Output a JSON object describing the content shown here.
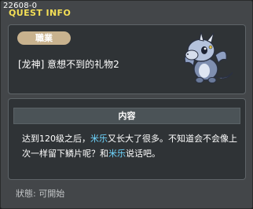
{
  "quest_id": "22608-0",
  "title": "QUEST INFO",
  "job_label": "職業",
  "quest_name": "[龙神] 意想不到的礼物2",
  "content_header": "内容",
  "description": {
    "part1": "达到120级之后，",
    "highlight1": "米乐",
    "part2": "又长大了很多。不知道会不会像上次一样留下鳞片呢？和",
    "highlight2": "米乐",
    "part3": "说话吧。"
  },
  "status": "狀態:  可開始",
  "colors": {
    "title": "#f4df56",
    "highlight": "#6fd6ff",
    "job_badge": "#c8b28e"
  },
  "icons": {
    "npc": "baby-dragon-icon"
  }
}
